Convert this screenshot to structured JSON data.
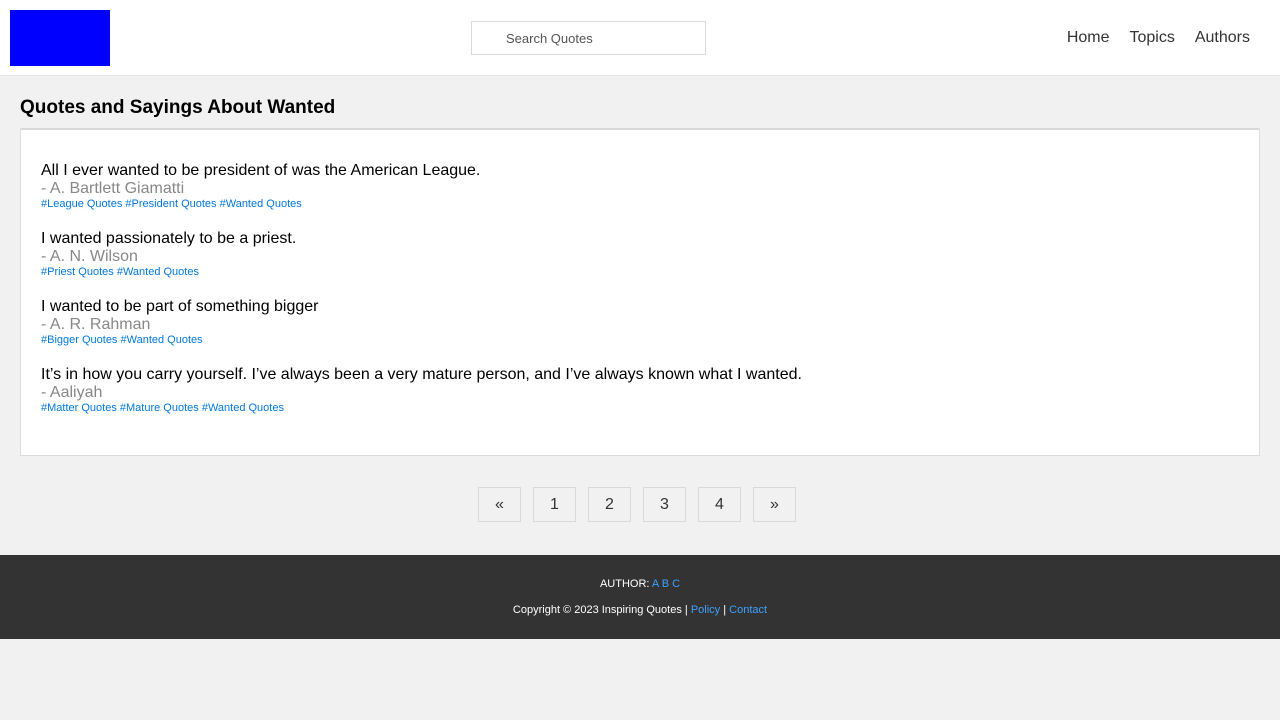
{
  "header": {
    "logo_color": "#0000ff",
    "search_placeholder": "Search Quotes",
    "nav": [
      "Home",
      "Topics",
      "Authors"
    ]
  },
  "main": {
    "title": "Quotes and Sayings About Wanted",
    "quotes": [
      {
        "text": "All I ever wanted to be president of was the American League.",
        "author": "- A. Bartlett Giamatti",
        "tags": [
          "#League Quotes",
          "#President Quotes",
          "#Wanted Quotes"
        ]
      },
      {
        "text": "I wanted passionately to be a priest.",
        "author": "- A. N. Wilson",
        "tags": [
          "#Priest Quotes",
          "#Wanted Quotes"
        ]
      },
      {
        "text": "I wanted to be part of something bigger",
        "author": "- A. R. Rahman",
        "tags": [
          "#Bigger Quotes",
          "#Wanted Quotes"
        ]
      },
      {
        "text": "It’s in how you carry yourself. I’ve always been a very mature person, and I’ve always known what I wanted.",
        "author": "- Aaliyah",
        "tags": [
          "#Matter Quotes",
          "#Mature Quotes",
          "#Wanted Quotes"
        ]
      }
    ]
  },
  "pagination": [
    "«",
    "1",
    "2",
    "3",
    "4",
    "»"
  ],
  "footer": {
    "author_label": "AUTHOR:",
    "author_letters": [
      "A",
      "B",
      "C"
    ],
    "copyright": "Copyright © 2023 Inspiring Quotes",
    "separator": "|",
    "policy": "Policy",
    "contact": "Contact"
  },
  "colors": {
    "link": "#0077dd",
    "footer_bg": "#333333",
    "footer_link": "#3ea0ff",
    "author": "#888888"
  }
}
